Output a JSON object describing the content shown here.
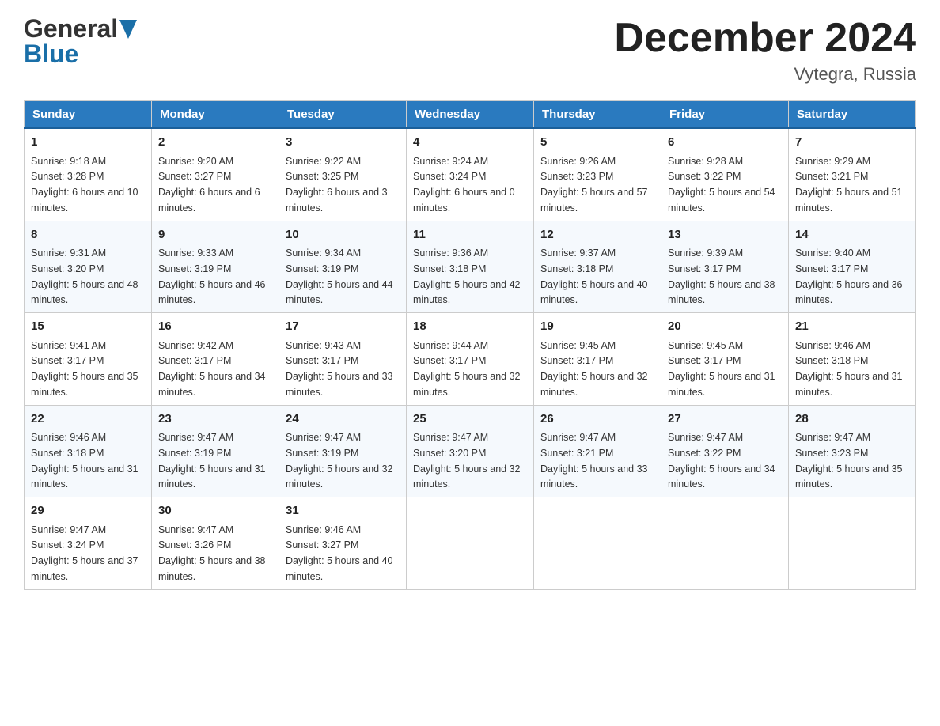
{
  "header": {
    "title": "December 2024",
    "location": "Vytegra, Russia",
    "logo_line1": "General",
    "logo_line2": "Blue"
  },
  "weekdays": [
    "Sunday",
    "Monday",
    "Tuesday",
    "Wednesday",
    "Thursday",
    "Friday",
    "Saturday"
  ],
  "weeks": [
    [
      {
        "day": "1",
        "sunrise": "9:18 AM",
        "sunset": "3:28 PM",
        "daylight": "6 hours and 10 minutes."
      },
      {
        "day": "2",
        "sunrise": "9:20 AM",
        "sunset": "3:27 PM",
        "daylight": "6 hours and 6 minutes."
      },
      {
        "day": "3",
        "sunrise": "9:22 AM",
        "sunset": "3:25 PM",
        "daylight": "6 hours and 3 minutes."
      },
      {
        "day": "4",
        "sunrise": "9:24 AM",
        "sunset": "3:24 PM",
        "daylight": "6 hours and 0 minutes."
      },
      {
        "day": "5",
        "sunrise": "9:26 AM",
        "sunset": "3:23 PM",
        "daylight": "5 hours and 57 minutes."
      },
      {
        "day": "6",
        "sunrise": "9:28 AM",
        "sunset": "3:22 PM",
        "daylight": "5 hours and 54 minutes."
      },
      {
        "day": "7",
        "sunrise": "9:29 AM",
        "sunset": "3:21 PM",
        "daylight": "5 hours and 51 minutes."
      }
    ],
    [
      {
        "day": "8",
        "sunrise": "9:31 AM",
        "sunset": "3:20 PM",
        "daylight": "5 hours and 48 minutes."
      },
      {
        "day": "9",
        "sunrise": "9:33 AM",
        "sunset": "3:19 PM",
        "daylight": "5 hours and 46 minutes."
      },
      {
        "day": "10",
        "sunrise": "9:34 AM",
        "sunset": "3:19 PM",
        "daylight": "5 hours and 44 minutes."
      },
      {
        "day": "11",
        "sunrise": "9:36 AM",
        "sunset": "3:18 PM",
        "daylight": "5 hours and 42 minutes."
      },
      {
        "day": "12",
        "sunrise": "9:37 AM",
        "sunset": "3:18 PM",
        "daylight": "5 hours and 40 minutes."
      },
      {
        "day": "13",
        "sunrise": "9:39 AM",
        "sunset": "3:17 PM",
        "daylight": "5 hours and 38 minutes."
      },
      {
        "day": "14",
        "sunrise": "9:40 AM",
        "sunset": "3:17 PM",
        "daylight": "5 hours and 36 minutes."
      }
    ],
    [
      {
        "day": "15",
        "sunrise": "9:41 AM",
        "sunset": "3:17 PM",
        "daylight": "5 hours and 35 minutes."
      },
      {
        "day": "16",
        "sunrise": "9:42 AM",
        "sunset": "3:17 PM",
        "daylight": "5 hours and 34 minutes."
      },
      {
        "day": "17",
        "sunrise": "9:43 AM",
        "sunset": "3:17 PM",
        "daylight": "5 hours and 33 minutes."
      },
      {
        "day": "18",
        "sunrise": "9:44 AM",
        "sunset": "3:17 PM",
        "daylight": "5 hours and 32 minutes."
      },
      {
        "day": "19",
        "sunrise": "9:45 AM",
        "sunset": "3:17 PM",
        "daylight": "5 hours and 32 minutes."
      },
      {
        "day": "20",
        "sunrise": "9:45 AM",
        "sunset": "3:17 PM",
        "daylight": "5 hours and 31 minutes."
      },
      {
        "day": "21",
        "sunrise": "9:46 AM",
        "sunset": "3:18 PM",
        "daylight": "5 hours and 31 minutes."
      }
    ],
    [
      {
        "day": "22",
        "sunrise": "9:46 AM",
        "sunset": "3:18 PM",
        "daylight": "5 hours and 31 minutes."
      },
      {
        "day": "23",
        "sunrise": "9:47 AM",
        "sunset": "3:19 PM",
        "daylight": "5 hours and 31 minutes."
      },
      {
        "day": "24",
        "sunrise": "9:47 AM",
        "sunset": "3:19 PM",
        "daylight": "5 hours and 32 minutes."
      },
      {
        "day": "25",
        "sunrise": "9:47 AM",
        "sunset": "3:20 PM",
        "daylight": "5 hours and 32 minutes."
      },
      {
        "day": "26",
        "sunrise": "9:47 AM",
        "sunset": "3:21 PM",
        "daylight": "5 hours and 33 minutes."
      },
      {
        "day": "27",
        "sunrise": "9:47 AM",
        "sunset": "3:22 PM",
        "daylight": "5 hours and 34 minutes."
      },
      {
        "day": "28",
        "sunrise": "9:47 AM",
        "sunset": "3:23 PM",
        "daylight": "5 hours and 35 minutes."
      }
    ],
    [
      {
        "day": "29",
        "sunrise": "9:47 AM",
        "sunset": "3:24 PM",
        "daylight": "5 hours and 37 minutes."
      },
      {
        "day": "30",
        "sunrise": "9:47 AM",
        "sunset": "3:26 PM",
        "daylight": "5 hours and 38 minutes."
      },
      {
        "day": "31",
        "sunrise": "9:46 AM",
        "sunset": "3:27 PM",
        "daylight": "5 hours and 40 minutes."
      },
      null,
      null,
      null,
      null
    ]
  ],
  "labels": {
    "sunrise": "Sunrise:",
    "sunset": "Sunset:",
    "daylight": "Daylight:"
  }
}
